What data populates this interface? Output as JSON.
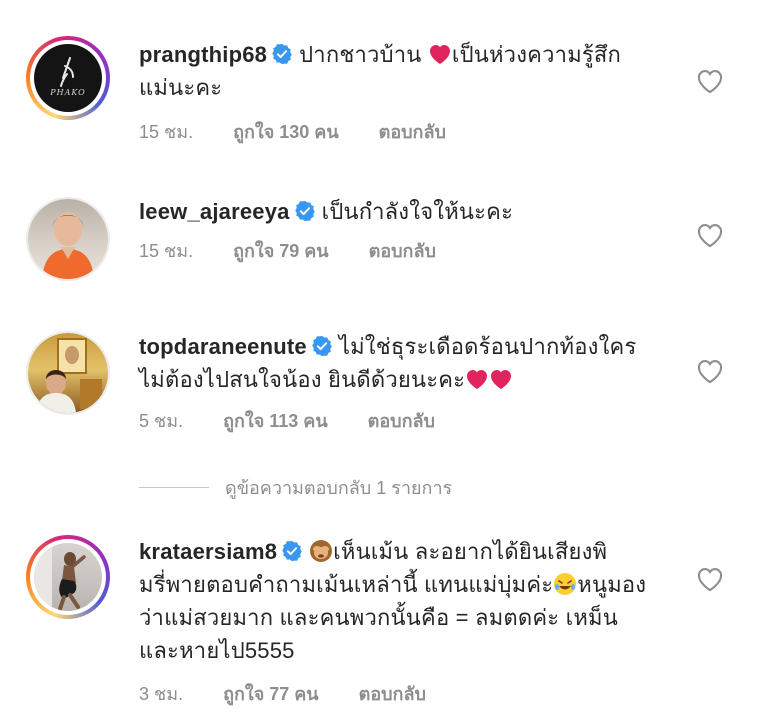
{
  "colors": {
    "text": "#262626",
    "secondary": "#8e8e8e",
    "verified": "#3897f0",
    "emoji_red": "#e0245e"
  },
  "view_replies_label": "ดูข้อความตอบกลับ 1 รายการ",
  "comments": [
    {
      "username": "prangthip68",
      "text_line1": "ปากชาวบ้าน",
      "text_line1b": "เป็นห่วงความรู้สึก",
      "text_line2": "แม่นะคะ",
      "time": "15 ชม.",
      "likes": "ถูกใจ 130 คน",
      "reply": "ตอบกลับ",
      "avatar_caption": "PHAKO"
    },
    {
      "username": "leew_ajareeya",
      "text": "เป็นกำลังใจให้นะคะ",
      "time": "15 ชม.",
      "likes": "ถูกใจ 79 คน",
      "reply": "ตอบกลับ"
    },
    {
      "username": "topdaraneenute",
      "text_line1": "ไม่ใช่ธุระเดือดร้อนปากท้องใคร",
      "text_line2": "ไม่ต้องไปสนใจน้อง ยินดีด้วยนะคะ",
      "time": "5 ชม.",
      "likes": "ถูกใจ 113 คน",
      "reply": "ตอบกลับ"
    },
    {
      "username": "krataersiam8",
      "text_line1": "เห็นเม้น ละอยากได้ยินเสียงพิ",
      "text_line2a": "มรี่พายตอบคำถามเม้นเหล่านี้ แทนแม่บุ่มค่ะ",
      "text_line2b": "หนูมอง",
      "text_line3": "ว่าแม่สวยมาก และคนพวกนั้นคือ = ลมตดค่ะ เหม็น",
      "text_line4": "และหายไป5555",
      "time": "3 ชม.",
      "likes": "ถูกใจ 77 คน",
      "reply": "ตอบกลับ"
    }
  ]
}
